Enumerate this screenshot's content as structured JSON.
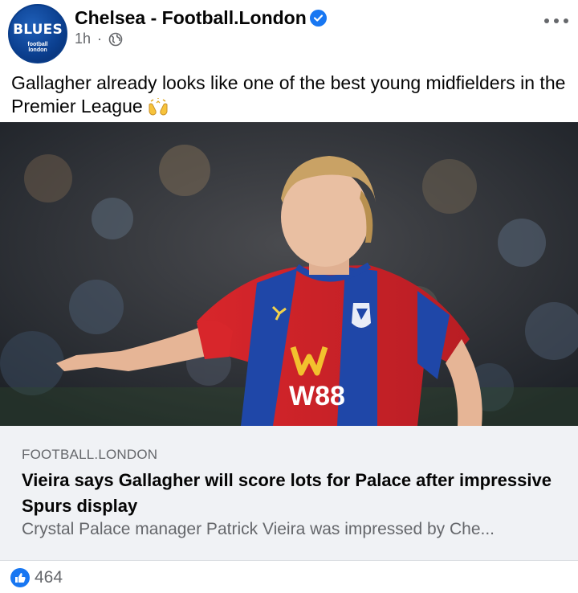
{
  "post": {
    "avatar": {
      "text": "BLUES",
      "subtext": "football london"
    },
    "page_name": "Chelsea - Football.London",
    "verified_icon": "verified-badge-icon",
    "time": "1h",
    "separator": "·",
    "audience_icon": "globe-icon",
    "more_icon": "more-options-icon",
    "caption": "Gallagher already looks like one of the best young midfielders in the Premier League"
  },
  "photo": {
    "description_icon": "player-photo",
    "shirt_sponsor": "W88"
  },
  "link": {
    "domain": "FOOTBALL.LONDON",
    "headline": "Vieira says Gallagher will score lots for Palace after impressive Spurs display",
    "description": "Crystal Palace manager Patrick Vieira was impressed by Che..."
  },
  "reactions": {
    "like_icon": "like-thumb-icon",
    "count": "464"
  },
  "colors": {
    "facebook_blue": "#1877f2",
    "secondary_text": "#65676b",
    "link_card_bg": "#f0f2f5"
  }
}
